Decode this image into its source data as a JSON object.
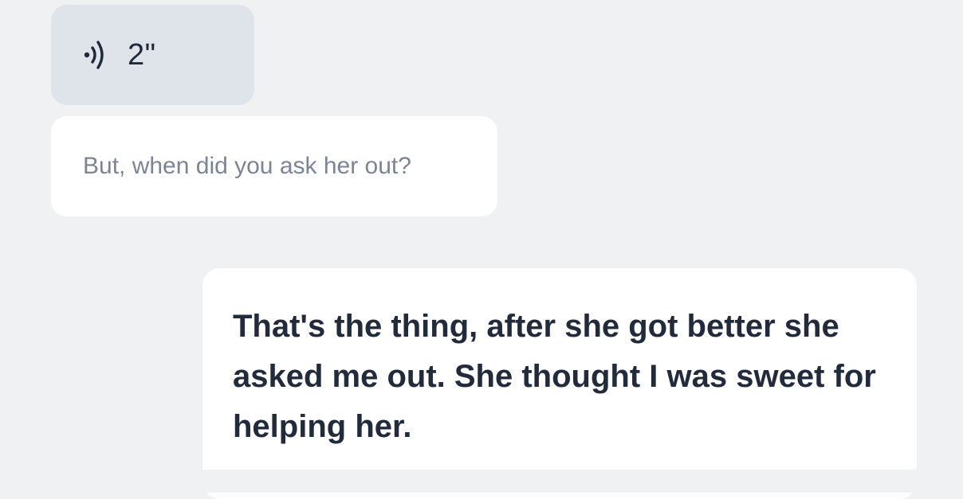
{
  "audio_message": {
    "icon": "sound-wave-icon",
    "duration": "2\""
  },
  "translation": {
    "text": "But, when did you ask her out?"
  },
  "reply": {
    "text": "That's the thing, after she got better she asked me out. She thought I was sweet for helping her."
  },
  "colors": {
    "background": "#f0f1f3",
    "audio_bubble": "#dfe3ea",
    "text_dark": "#222b3c",
    "text_muted": "#7c8494"
  }
}
